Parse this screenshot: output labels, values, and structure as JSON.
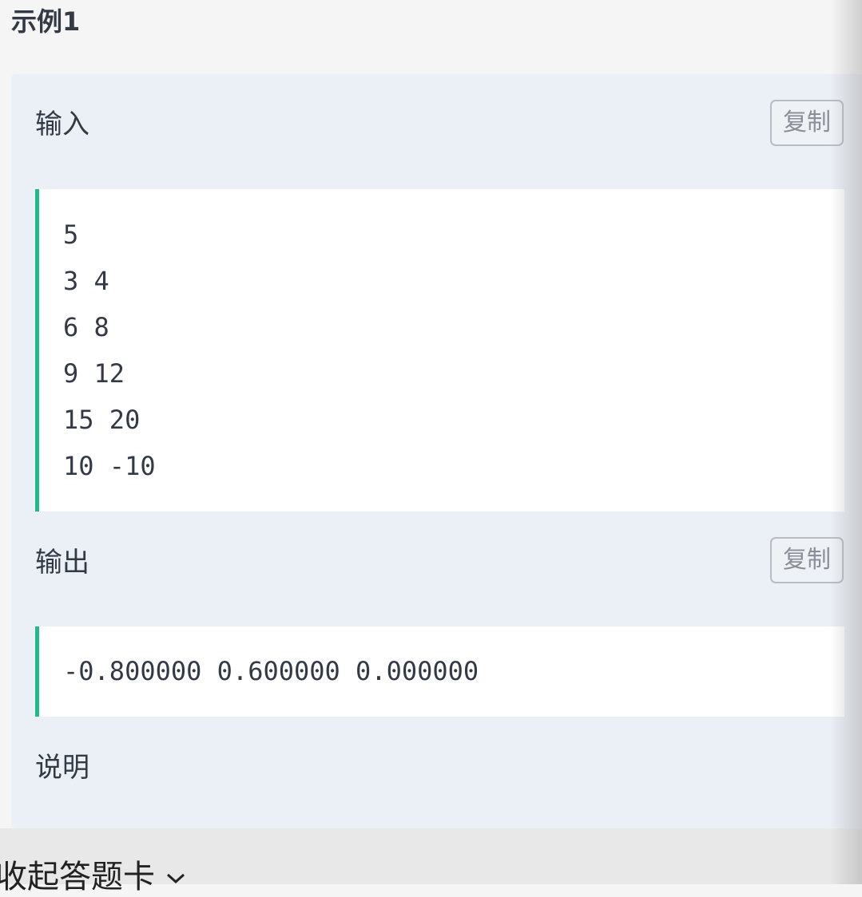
{
  "title": "示例1",
  "input": {
    "label": "输入",
    "copy": "复制",
    "lines": [
      "5",
      "3 4",
      "6 8",
      "9 12",
      "15 20",
      "10 -10"
    ]
  },
  "output": {
    "label": "输出",
    "copy": "复制",
    "lines": [
      "-0.800000 0.600000 0.000000"
    ]
  },
  "explain": {
    "label": "说明"
  },
  "footer": {
    "collapse_label": "收起答题卡",
    "icon": "chevron-down-icon"
  },
  "colors": {
    "accent": "#1cbc8c"
  }
}
